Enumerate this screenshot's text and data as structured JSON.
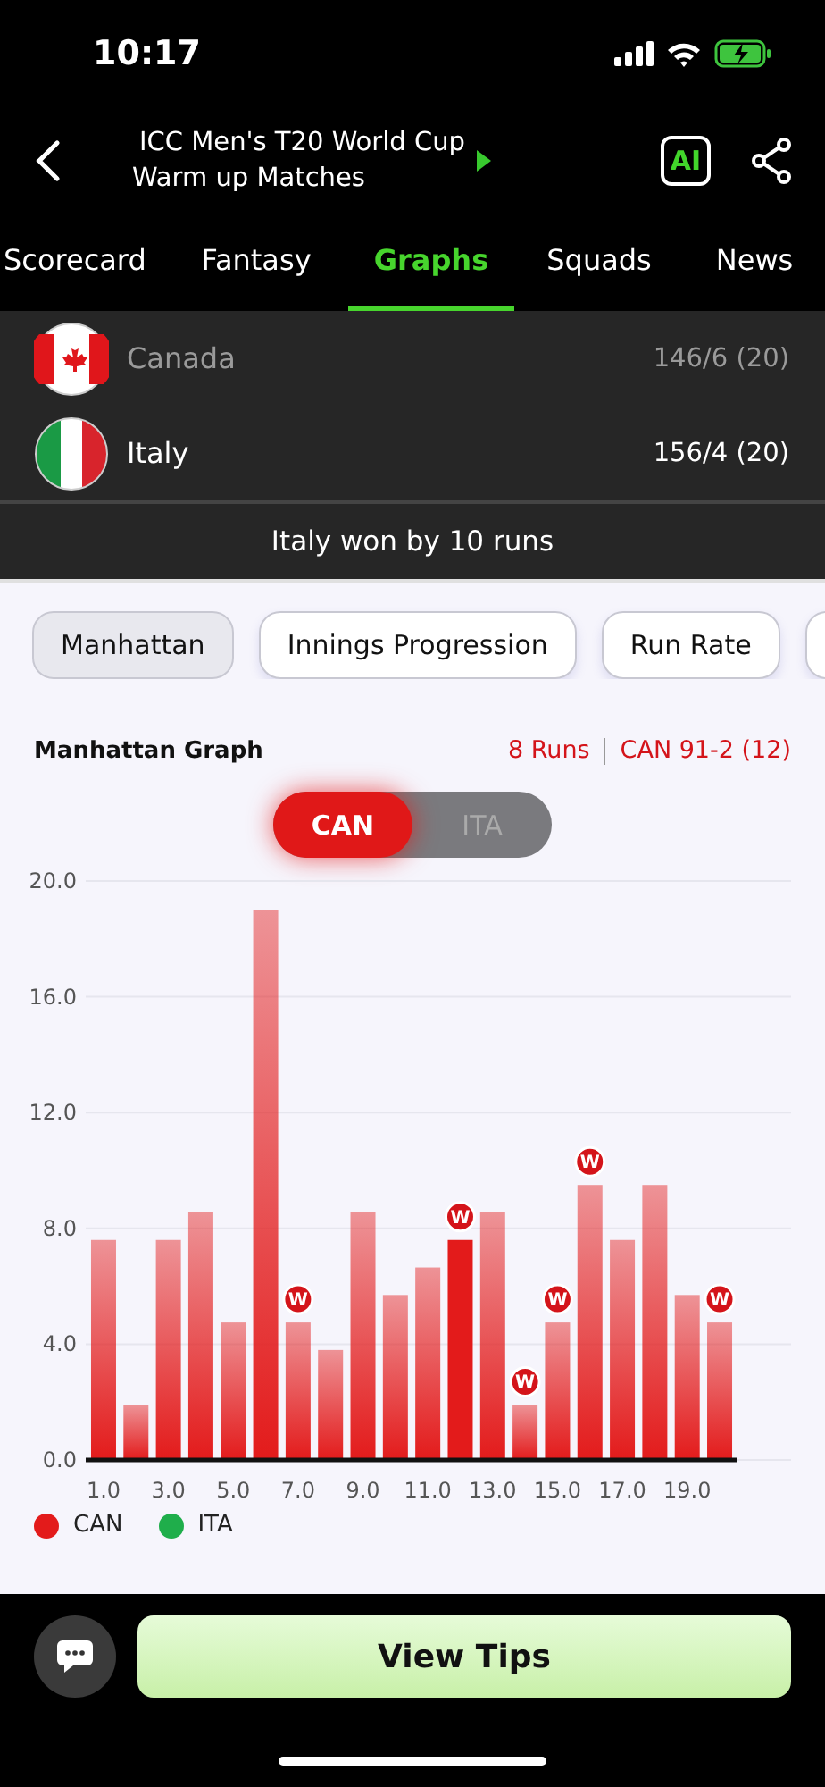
{
  "status_bar": {
    "time": "10:17"
  },
  "header": {
    "title_lines": [
      "ICC Men's T20 World Cup",
      "Warm up Matches"
    ],
    "ai_badge": "AI"
  },
  "tabs": [
    {
      "label": "Scorecard",
      "selected": false
    },
    {
      "label": "Fantasy",
      "selected": false
    },
    {
      "label": "Graphs",
      "selected": true
    },
    {
      "label": "Squads",
      "selected": false
    },
    {
      "label": "News",
      "selected": false
    }
  ],
  "teams": [
    {
      "name": "Canada",
      "score": "146/6 (20)",
      "kind": "canada",
      "dimmed": true
    },
    {
      "name": "Italy",
      "score": "156/4 (20)",
      "kind": "italy",
      "dimmed": false
    }
  ],
  "result": "Italy won by 10 runs",
  "graph_tabs": [
    {
      "label": "Manhattan",
      "selected": true
    },
    {
      "label": "Innings Progression",
      "selected": false
    },
    {
      "label": "Run Rate",
      "selected": false
    }
  ],
  "graph": {
    "title": "Manhattan Graph",
    "over_runs": "8 Runs",
    "over_score": "CAN 91-2 (12)",
    "team_toggle": [
      {
        "label": "CAN",
        "selected": true
      },
      {
        "label": "ITA",
        "selected": false
      }
    ],
    "bars": [
      {
        "selected": false
      },
      {
        "selected": false
      },
      {
        "selected": false
      },
      {
        "selected": false
      },
      {
        "selected": false
      },
      {
        "selected": false
      },
      {
        "selected": false
      },
      {
        "selected": false
      },
      {
        "selected": false
      },
      {
        "selected": false
      },
      {
        "selected": false
      },
      {
        "selected": true
      },
      {
        "selected": false
      },
      {
        "selected": false
      },
      {
        "selected": false
      },
      {
        "selected": false
      },
      {
        "selected": false
      },
      {
        "selected": false
      },
      {
        "selected": false
      },
      {
        "selected": false
      }
    ],
    "chart_data": {
      "type": "bar",
      "x": [
        1,
        2,
        3,
        4,
        5,
        6,
        7,
        8,
        9,
        10,
        11,
        12,
        13,
        14,
        15,
        16,
        17,
        18,
        19,
        20
      ],
      "xticks": [
        {
          "value": 1,
          "label": "1.0"
        },
        {
          "value": 3,
          "label": "3.0"
        },
        {
          "value": 5,
          "label": "5.0"
        },
        {
          "value": 7,
          "label": "7.0"
        },
        {
          "value": 9,
          "label": "9.0"
        },
        {
          "value": 11,
          "label": "11.0"
        },
        {
          "value": 13,
          "label": "13.0"
        },
        {
          "value": 15,
          "label": "15.0"
        },
        {
          "value": 17,
          "label": "17.0"
        },
        {
          "value": 19,
          "label": "19.0"
        }
      ],
      "yticks": [
        {
          "value": 0,
          "label": "0.0"
        },
        {
          "value": 4,
          "label": "4.0"
        },
        {
          "value": 8,
          "label": "8.0"
        },
        {
          "value": 12,
          "label": "12.0"
        },
        {
          "value": 16,
          "label": "16.0"
        },
        {
          "value": 20,
          "label": "20.0"
        }
      ],
      "xlim": [
        0.45,
        20.55
      ],
      "ylim": [
        0,
        20
      ],
      "grid": true,
      "series": [
        {
          "name": "CAN",
          "color": "#e31b1b",
          "values": [
            7.6,
            1.9,
            7.6,
            8.55,
            4.75,
            19,
            4.75,
            3.8,
            8.55,
            5.7,
            6.65,
            7.6,
            8.55,
            1.9,
            4.75,
            9.5,
            7.6,
            9.5,
            5.7,
            4.75
          ]
        },
        {
          "name": "ITA",
          "color": "#1fae4b",
          "values": [
            null,
            null,
            null,
            null,
            null,
            null,
            null,
            null,
            null,
            null,
            null,
            null,
            null,
            null,
            null,
            null,
            null,
            null,
            null,
            null
          ]
        }
      ],
      "annotations": [
        {
          "x": 7,
          "y": 4.75,
          "text": "W"
        },
        {
          "x": 12,
          "y": 7.6,
          "text": "W"
        },
        {
          "x": 14,
          "y": 1.9,
          "text": "W"
        },
        {
          "x": 15,
          "y": 4.75,
          "text": "W"
        },
        {
          "x": 16,
          "y": 9.5,
          "text": "W"
        },
        {
          "x": 20,
          "y": 4.75,
          "text": "W"
        }
      ]
    }
  },
  "footer": {
    "button": "View Tips"
  }
}
